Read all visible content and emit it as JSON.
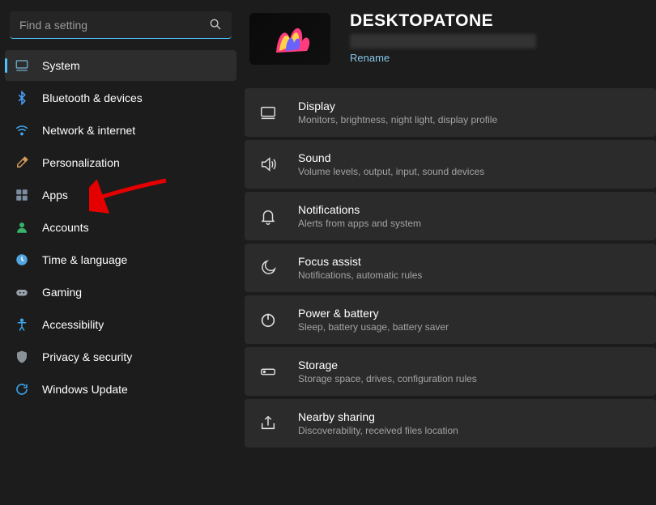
{
  "search": {
    "placeholder": "Find a setting"
  },
  "sidebar": {
    "items": [
      {
        "label": "System"
      },
      {
        "label": "Bluetooth & devices"
      },
      {
        "label": "Network & internet"
      },
      {
        "label": "Personalization"
      },
      {
        "label": "Apps"
      },
      {
        "label": "Accounts"
      },
      {
        "label": "Time & language"
      },
      {
        "label": "Gaming"
      },
      {
        "label": "Accessibility"
      },
      {
        "label": "Privacy & security"
      },
      {
        "label": "Windows Update"
      }
    ]
  },
  "header": {
    "device_name": "DESKTOPATONE",
    "rename": "Rename"
  },
  "cards": [
    {
      "title": "Display",
      "desc": "Monitors, brightness, night light, display profile"
    },
    {
      "title": "Sound",
      "desc": "Volume levels, output, input, sound devices"
    },
    {
      "title": "Notifications",
      "desc": "Alerts from apps and system"
    },
    {
      "title": "Focus assist",
      "desc": "Notifications, automatic rules"
    },
    {
      "title": "Power & battery",
      "desc": "Sleep, battery usage, battery saver"
    },
    {
      "title": "Storage",
      "desc": "Storage space, drives, configuration rules"
    },
    {
      "title": "Nearby sharing",
      "desc": "Discoverability, received files location"
    }
  ]
}
